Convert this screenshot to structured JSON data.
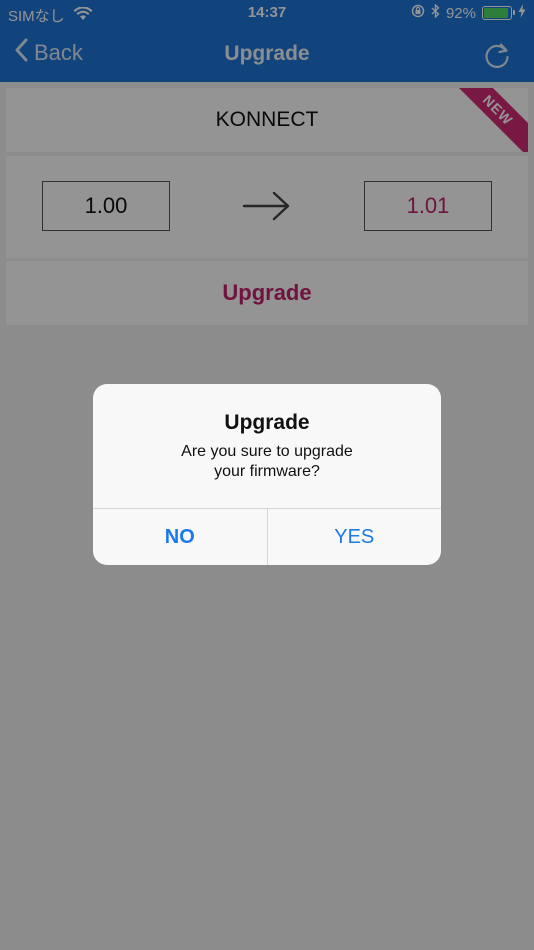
{
  "status": {
    "carrier": "SIMなし",
    "time": "14:37",
    "battery_percent_text": "92%",
    "battery_level": 0.92,
    "icons": [
      "wifi-icon",
      "rotation-lock-icon",
      "bluetooth-icon",
      "battery-icon",
      "charging-bolt-icon"
    ]
  },
  "nav": {
    "back_label": "Back",
    "title": "Upgrade",
    "refresh_icon": "refresh-icon"
  },
  "device": {
    "name": "KONNECT",
    "badge": "NEW"
  },
  "versions": {
    "current": "1.00",
    "available": "1.01",
    "arrow_icon": "arrow-right-icon"
  },
  "action": {
    "upgrade_label": "Upgrade"
  },
  "dialog": {
    "title": "Upgrade",
    "message_line1": "Are you sure to upgrade",
    "message_line2": "your firmware?",
    "no_label": "NO",
    "yes_label": "YES"
  },
  "colors": {
    "nav_blue": "#1e74d8",
    "accent_magenta": "#c2236d",
    "ribbon": "#d12a74",
    "dialog_button_blue": "#1a7ae6",
    "battery_green": "#4cd964"
  }
}
